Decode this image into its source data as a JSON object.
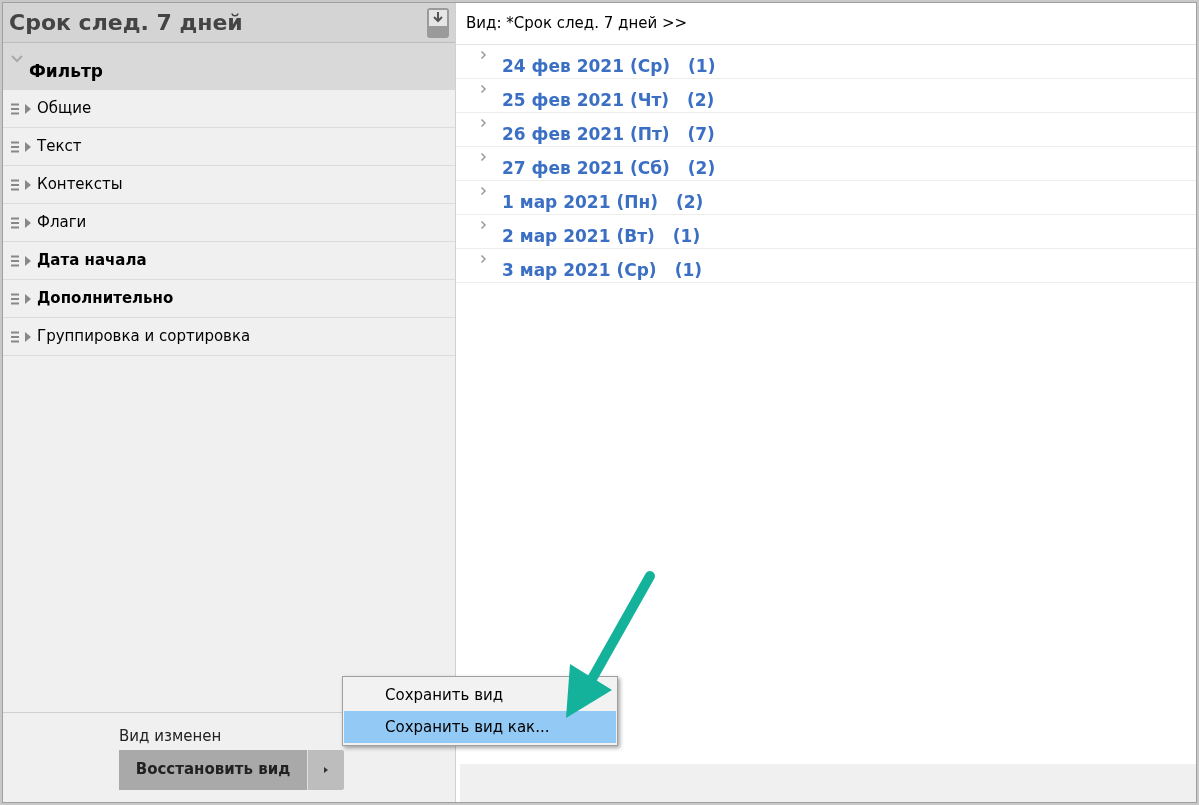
{
  "sidebar": {
    "title": "Срок след. 7 дней",
    "filter": {
      "label": "Фильтр",
      "expanded": true,
      "items": [
        {
          "label": "Общие",
          "active": false
        },
        {
          "label": "Текст",
          "active": false
        },
        {
          "label": "Контексты",
          "active": false
        },
        {
          "label": "Флаги",
          "active": false
        },
        {
          "label": "Дата начала",
          "active": true
        },
        {
          "label": "Дополнительно",
          "active": true
        },
        {
          "label": "Группировка и сортировка",
          "active": false
        }
      ]
    },
    "status": "Вид изменен",
    "restore_button": "Восстановить вид"
  },
  "view": {
    "title": "Вид: *Срок след. 7 дней >>",
    "groups": [
      {
        "label": "24 фев 2021 (Ср)",
        "count": "(1)"
      },
      {
        "label": "25 фев 2021 (Чт)",
        "count": "(2)"
      },
      {
        "label": "26 фев 2021 (Пт)",
        "count": "(7)"
      },
      {
        "label": "27 фев 2021 (Сб)",
        "count": "(2)"
      },
      {
        "label": "1 мар 2021 (Пн)",
        "count": "(2)"
      },
      {
        "label": "2 мар 2021 (Вт)",
        "count": "(1)"
      },
      {
        "label": "3 мар 2021 (Ср)",
        "count": "(1)"
      }
    ]
  },
  "menu": {
    "items": [
      {
        "label": "Сохранить вид",
        "selected": false
      },
      {
        "label": "Сохранить вид как...",
        "selected": true
      }
    ]
  }
}
